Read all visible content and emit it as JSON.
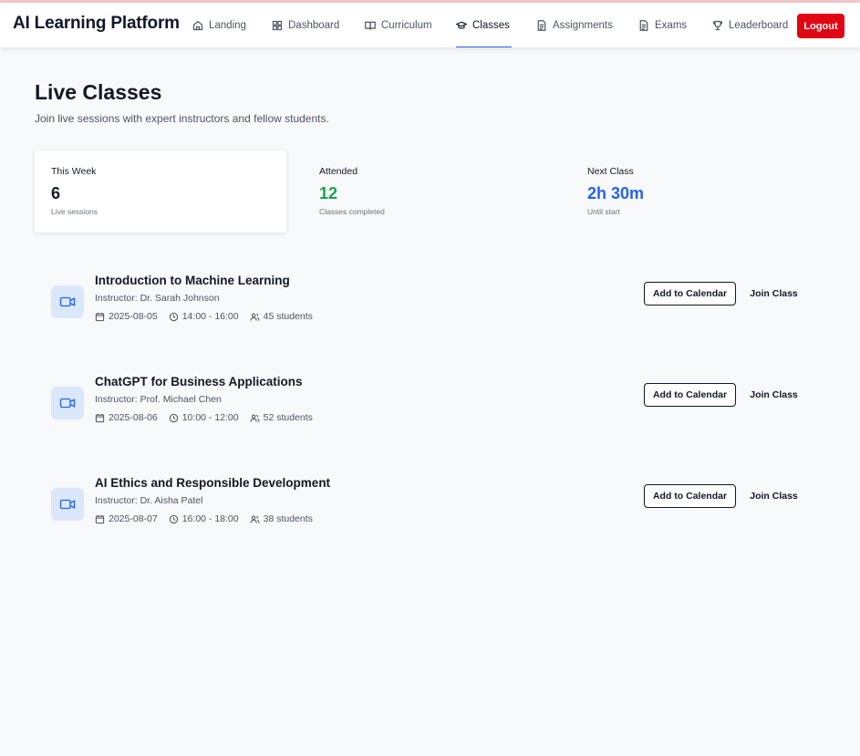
{
  "app": {
    "brand": "AI Learning Platform"
  },
  "nav": {
    "items": [
      {
        "label": "Landing",
        "icon": "home-icon"
      },
      {
        "label": "Dashboard",
        "icon": "grid-icon"
      },
      {
        "label": "Curriculum",
        "icon": "book-icon"
      },
      {
        "label": "Classes",
        "icon": "graduation-cap-icon",
        "active": true
      },
      {
        "label": "Assignments",
        "icon": "document-icon"
      },
      {
        "label": "Exams",
        "icon": "document-icon"
      },
      {
        "label": "Leaderboard",
        "icon": "trophy-icon"
      }
    ],
    "logout_label": "Logout"
  },
  "page": {
    "title": "Live Classes",
    "subtitle": "Join live sessions with expert instructors and fellow students."
  },
  "stats": [
    {
      "label": "This Week",
      "value": "6",
      "sub": "Live sessions",
      "color": "#111827"
    },
    {
      "label": "Attended",
      "value": "12",
      "sub": "Classes completed",
      "color": "#16a34a"
    },
    {
      "label": "Next Class",
      "value": "2h 30m",
      "sub": "Until start",
      "color": "#2563eb"
    }
  ],
  "classes": [
    {
      "title": "Introduction to Machine Learning",
      "instructor": "Instructor: Dr. Sarah Johnson",
      "date": "2025-08-05",
      "time": "14:00 - 16:00",
      "students": "45 students"
    },
    {
      "title": "ChatGPT for Business Applications",
      "instructor": "Instructor: Prof. Michael Chen",
      "date": "2025-08-06",
      "time": "10:00 - 12:00",
      "students": "52 students"
    },
    {
      "title": "AI Ethics and Responsible Development",
      "instructor": "Instructor: Dr. Aisha Patel",
      "date": "2025-08-07",
      "time": "16:00 - 18:00",
      "students": "38 students"
    }
  ],
  "actions": {
    "add_calendar": "Add to Calendar",
    "join": "Join Class"
  },
  "colors": {
    "accent": "#2563eb",
    "danger": "#e10613",
    "success": "#16a34a"
  }
}
